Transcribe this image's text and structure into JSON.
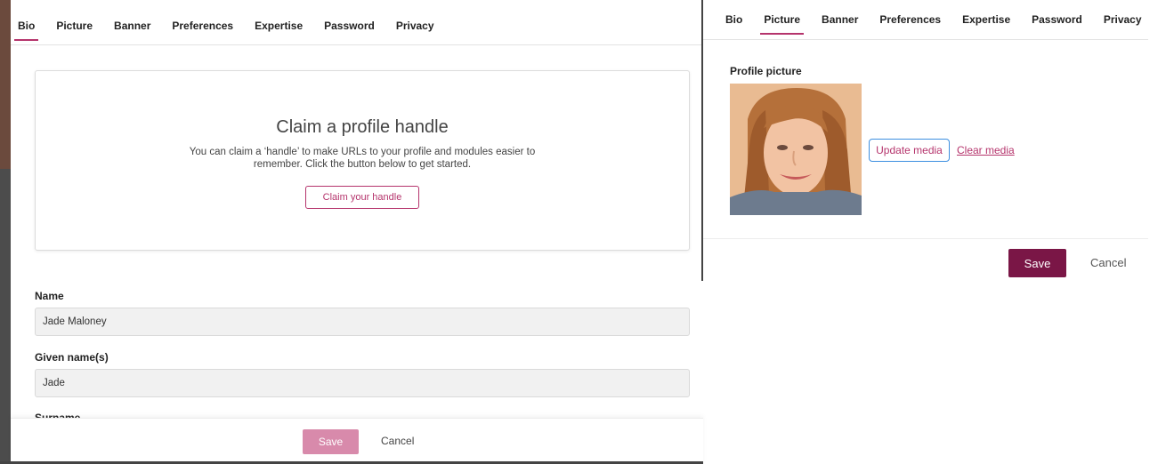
{
  "left": {
    "tabs": [
      {
        "label": "Bio",
        "active": true
      },
      {
        "label": "Picture",
        "active": false
      },
      {
        "label": "Banner",
        "active": false
      },
      {
        "label": "Preferences",
        "active": false
      },
      {
        "label": "Expertise",
        "active": false
      },
      {
        "label": "Password",
        "active": false
      },
      {
        "label": "Privacy",
        "active": false
      }
    ],
    "claim": {
      "title": "Claim a profile handle",
      "description": "You can claim a ‘handle’ to make URLs to your profile and modules easier to remember. Click the button below to get started.",
      "button_label": "Claim your handle"
    },
    "fields": {
      "name_label": "Name",
      "name_value": "Jade Maloney",
      "given_label": "Given name(s)",
      "given_value": "Jade",
      "surname_label": "Surname"
    },
    "footer": {
      "save_label": "Save",
      "cancel_label": "Cancel"
    }
  },
  "right": {
    "tabs": [
      {
        "label": "Bio",
        "active": false
      },
      {
        "label": "Picture",
        "active": true
      },
      {
        "label": "Banner",
        "active": false
      },
      {
        "label": "Preferences",
        "active": false
      },
      {
        "label": "Expertise",
        "active": false
      },
      {
        "label": "Password",
        "active": false
      },
      {
        "label": "Privacy",
        "active": false
      }
    ],
    "picture_label": "Profile picture",
    "update_label": "Update media",
    "clear_label": "Clear media",
    "footer": {
      "save_label": "Save",
      "cancel_label": "Cancel"
    }
  },
  "colors": {
    "accent": "#b5346c",
    "save_active": "#7a1646",
    "save_disabled": "#d88aab",
    "focus_ring": "#3d8fe0"
  }
}
